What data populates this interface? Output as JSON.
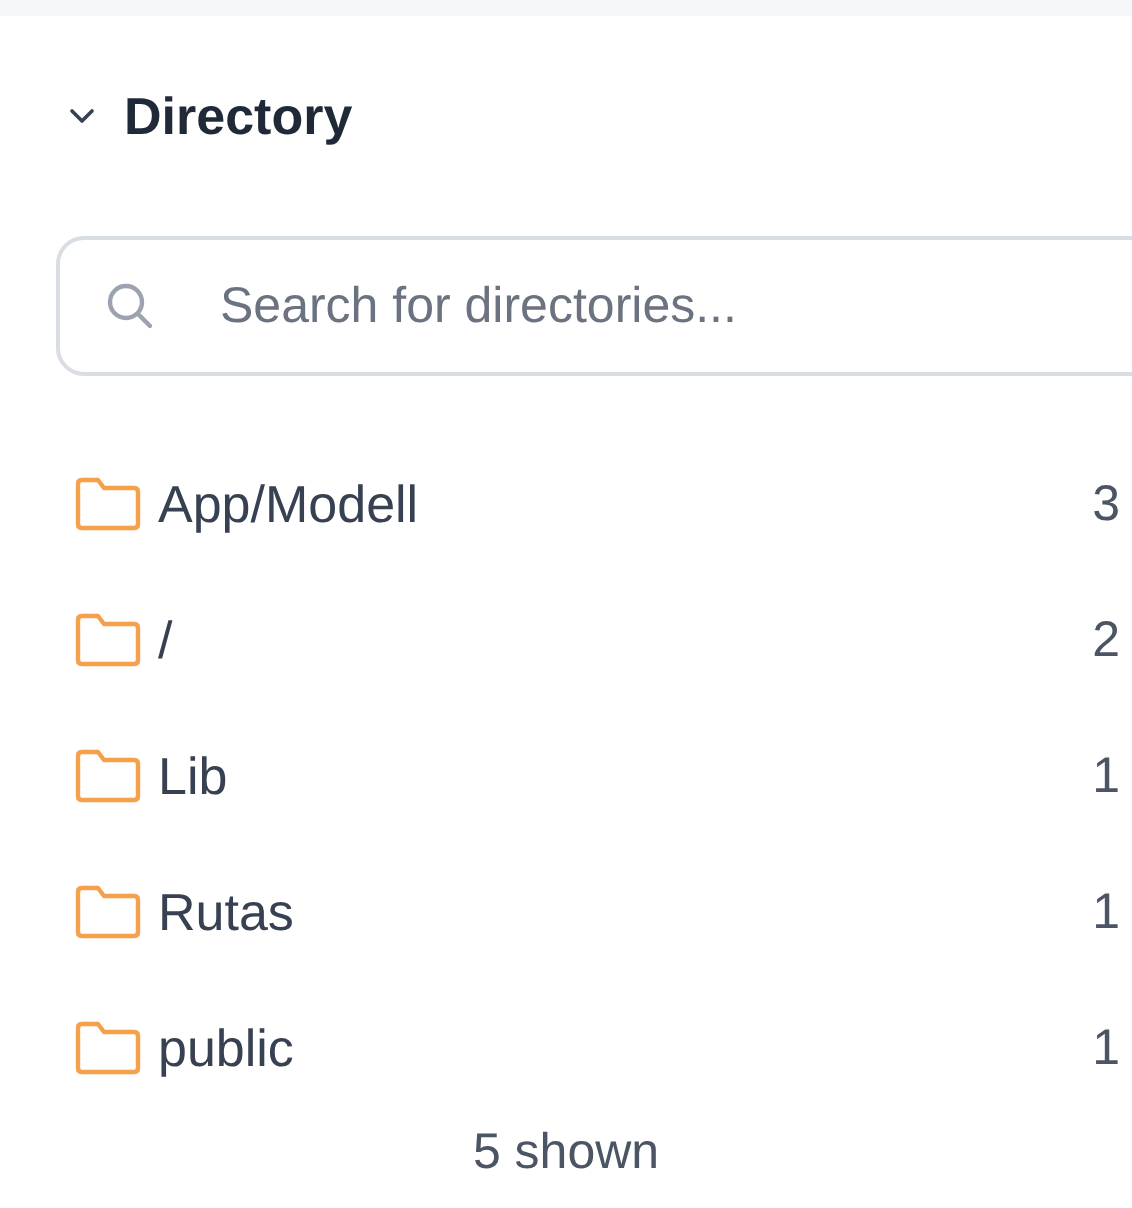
{
  "section": {
    "title": "Directory",
    "expanded": true
  },
  "search": {
    "placeholder": "Search for directories..."
  },
  "directories": [
    {
      "name": "App/Modell",
      "count": "3"
    },
    {
      "name": "/",
      "count": "2"
    },
    {
      "name": "Lib",
      "count": "1"
    },
    {
      "name": "Rutas",
      "count": "1"
    },
    {
      "name": "public",
      "count": "1"
    }
  ],
  "footer": "5 shown"
}
